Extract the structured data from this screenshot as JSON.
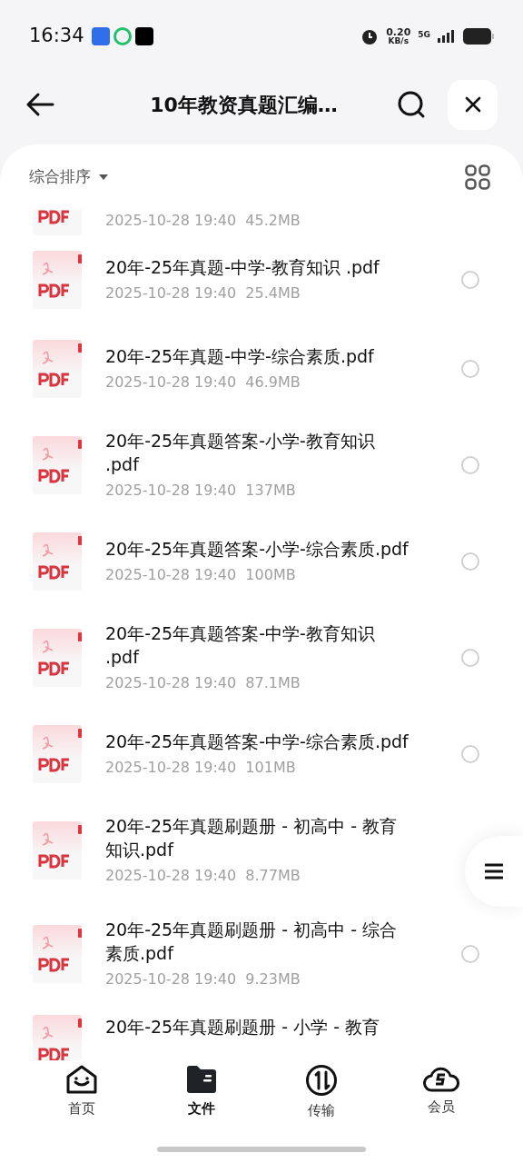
{
  "status_bar": {
    "time": "16:34",
    "net_speed": "0.20",
    "net_unit": "KB/s",
    "network": "5G"
  },
  "header": {
    "title": "10年教资真题汇编…"
  },
  "sort": {
    "label": "综合排序"
  },
  "files": [
    {
      "kind": "partial_top",
      "meta": "2025-10-28 19:40  45.2MB"
    },
    {
      "kind": "file",
      "name": "20年-25年真题-中学-教育知识 .pdf",
      "meta": "2025-10-28 19:40  25.4MB",
      "selected": false
    },
    {
      "kind": "file",
      "name": "20年-25年真题-中学-综合素质.pdf",
      "meta": "2025-10-28 19:40  46.9MB",
      "selected": false
    },
    {
      "kind": "file",
      "name": "20年-25年真题答案-小学-教育知识 .pdf",
      "meta": "2025-10-28 19:40  137MB",
      "selected": false
    },
    {
      "kind": "file",
      "name": "20年-25年真题答案-小学-综合素质.pdf",
      "meta": "2025-10-28 19:40  100MB",
      "selected": false
    },
    {
      "kind": "file",
      "name": "20年-25年真题答案-中学-教育知识 .pdf",
      "meta": "2025-10-28 19:40  87.1MB",
      "selected": false
    },
    {
      "kind": "file",
      "name": "20年-25年真题答案-中学-综合素质.pdf",
      "meta": "2025-10-28 19:40  101MB",
      "selected": false
    },
    {
      "kind": "file",
      "name": "20年-25年真题刷题册 - 初高中 - 教育知识.pdf",
      "meta": "2025-10-28 19:40  8.77MB"
    },
    {
      "kind": "file",
      "name": "20年-25年真题刷题册 - 初高中 - 综合素质.pdf",
      "meta": "2025-10-28 19:40  9.23MB",
      "selected": false
    },
    {
      "kind": "partial_bottom",
      "name": "20年-25年真题刷题册 - 小学 - 教育"
    }
  ],
  "nav": [
    {
      "label": "首页",
      "selected": false
    },
    {
      "label": "文件",
      "selected": true
    },
    {
      "label": "传输",
      "selected": false
    },
    {
      "label": "会员",
      "selected": false
    }
  ]
}
